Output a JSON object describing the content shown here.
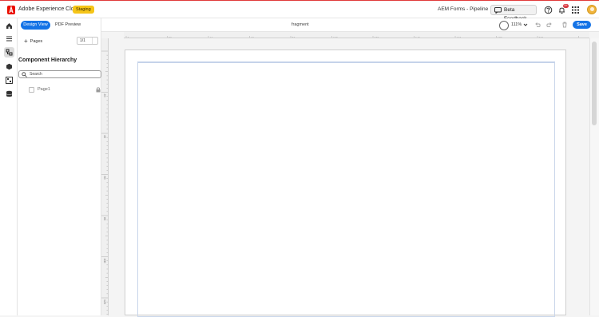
{
  "header": {
    "app_title": "Adobe Experience Cloud",
    "env_badge": "Staging",
    "context_title": "AEM Forms - Pipeline",
    "feedback_label": "Beta Feedback",
    "notification_count": "9+"
  },
  "rail": {
    "icons": [
      "home-icon",
      "menu-icon",
      "component-tree-icon",
      "components-icon",
      "data-model-icon",
      "database-icon"
    ],
    "active_index": 2
  },
  "panel": {
    "tabs": {
      "design": "Design View",
      "pdf": "PDF Preview"
    },
    "pages_label": "Pages",
    "page_select_value": "1/1",
    "hierarchy_title": "Component Hierarchy",
    "search_placeholder": "Search",
    "tree": [
      {
        "label": "Page1",
        "locked": true
      }
    ]
  },
  "canvas": {
    "fragment_name": "fragment",
    "zoom": "111%",
    "save_label": "Save",
    "ruler_h": [
      "0",
      "20",
      "40",
      "60",
      "80",
      "100",
      "120",
      "140",
      "160",
      "180",
      "200"
    ],
    "ruler_v": [
      "20",
      "40",
      "60",
      "80",
      "100",
      "120"
    ]
  },
  "colors": {
    "accent": "#1473e6",
    "brand": "#eb1000",
    "badge": "#f5c518"
  }
}
